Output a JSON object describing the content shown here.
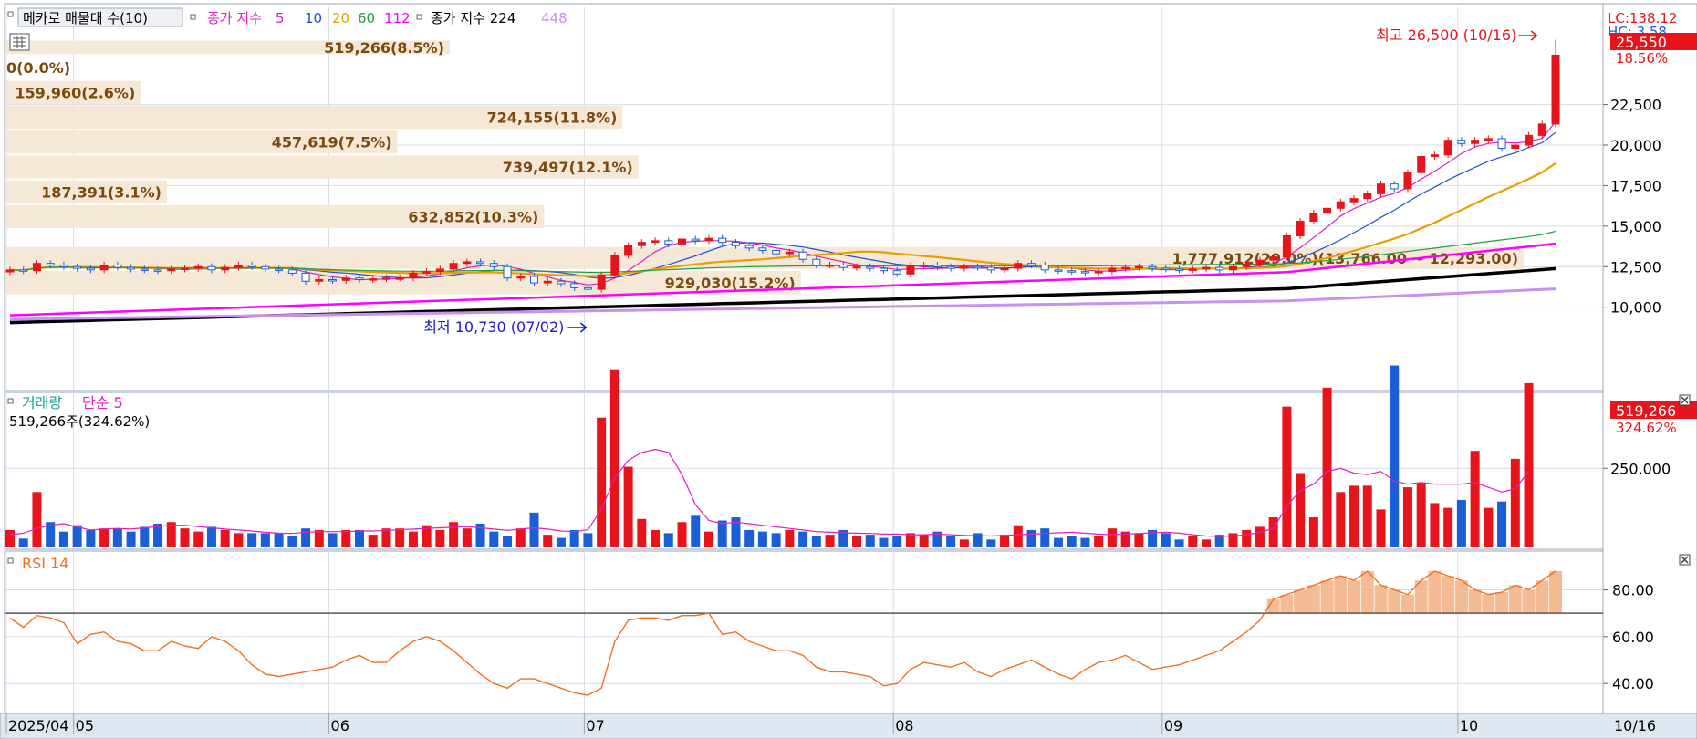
{
  "chart_data": [
    {
      "type": "candlestick",
      "legend": {
        "toggle_label": "메카로 매물대 수(10)",
        "ma_label": "종가 지수",
        "ma_periods": [
          {
            "label": "5",
            "color": "#e020c0"
          },
          {
            "label": "10",
            "color": "#2050d0"
          },
          {
            "label": "20",
            "color": "#e8a000"
          },
          {
            "label": "60",
            "color": "#20a040"
          },
          {
            "label": "112",
            "color": "#ff00ff"
          }
        ],
        "ma2_label": "종가 지수 224",
        "ma2_color": "#000000",
        "ma3_label": "448",
        "ma3_color": "#c890f0"
      },
      "ylim": [
        8800,
        28500
      ],
      "y_ticks": [
        "22,500",
        "20,000",
        "17,500",
        "15,000",
        "12,500",
        "10,000"
      ],
      "y_tick_values": [
        22500,
        20000,
        17500,
        15000,
        12500,
        10000
      ],
      "lc_label": "LC:138.12",
      "hc_label": "HC: 3.58",
      "price_box": "25,550",
      "change_pct": "18.56%",
      "high_annotation": "최고 26,500 (10/16)",
      "low_annotation": "최저 10,730 (07/02)",
      "colors": {
        "up": "#e8141c",
        "down": "#1a5fd6",
        "profile": "#f5e6d3",
        "profile_text": "#7a4a10",
        "rsi": "#f07020",
        "rsi_fill": "#f4b48a"
      },
      "volume_profile": [
        {
          "label": "519,266(8.5%)",
          "pct": 8.5,
          "low": 25550,
          "high": 26500
        },
        {
          "label": "0(0.0%)",
          "pct": 0.0,
          "low": 24010,
          "high": 25550
        },
        {
          "label": "159,960(2.6%)",
          "pct": 2.6,
          "low": 22480,
          "high": 24010
        },
        {
          "label": "724,155(11.8%)",
          "pct": 11.8,
          "low": 20950,
          "high": 22480
        },
        {
          "label": "457,619(7.5%)",
          "pct": 7.5,
          "low": 19420,
          "high": 20950
        },
        {
          "label": "739,497(12.1%)",
          "pct": 12.1,
          "low": 17880,
          "high": 19420
        },
        {
          "label": "187,391(3.1%)",
          "pct": 3.1,
          "low": 16350,
          "high": 17880
        },
        {
          "label": "632,852(10.3%)",
          "pct": 10.3,
          "low": 14820,
          "high": 16350
        },
        {
          "label": "1,777,912(29.0%)(13,766.00 ~ 12,293.00)",
          "pct": 29.0,
          "low": 12293,
          "high": 13766
        },
        {
          "label": "929,030(15.2%)",
          "pct": 15.2,
          "low": 10730,
          "high": 12293
        }
      ],
      "x_labels": [
        {
          "label": "2025/04",
          "index": 0
        },
        {
          "label": "05",
          "index": 5
        },
        {
          "label": "06",
          "index": 24
        },
        {
          "label": "07",
          "index": 43
        },
        {
          "label": "08",
          "index": 66
        },
        {
          "label": "09",
          "index": 86
        },
        {
          "label": "10",
          "index": 108
        }
      ],
      "date_box": "10/16",
      "highlight": {
        "high_index": 114,
        "low_index": 43
      },
      "close": [
        12300,
        12250,
        12700,
        12600,
        12500,
        12400,
        12300,
        12600,
        12450,
        12350,
        12300,
        12250,
        12350,
        12400,
        12500,
        12300,
        12450,
        12600,
        12500,
        12350,
        12300,
        12100,
        11600,
        11700,
        11650,
        11800,
        11700,
        11750,
        11800,
        11800,
        12100,
        12200,
        12350,
        12700,
        12800,
        12700,
        12500,
        11800,
        11900,
        11500,
        11600,
        11450,
        11200,
        11100,
        12000,
        13200,
        13800,
        14000,
        14100,
        13900,
        14200,
        14100,
        14250,
        14000,
        13800,
        13650,
        13500,
        13300,
        13400,
        12950,
        12600,
        12600,
        12450,
        12500,
        12400,
        12250,
        12050,
        12550,
        12600,
        12500,
        12400,
        12500,
        12450,
        12300,
        12400,
        12700,
        12600,
        12300,
        12250,
        12200,
        12150,
        12200,
        12400,
        12450,
        12500,
        12400,
        12350,
        12300,
        12350,
        12450,
        12300,
        12500,
        12650,
        12900,
        13100,
        14400,
        15300,
        15800,
        16100,
        16500,
        16700,
        17000,
        17600,
        17300,
        18300,
        19300,
        19400,
        20300,
        20100,
        20300,
        20400,
        19800,
        20000,
        20600,
        21300,
        25550
      ],
      "volume": [
        55000,
        28000,
        175000,
        80000,
        50000,
        70000,
        55000,
        60000,
        60000,
        50000,
        65000,
        75000,
        80000,
        60000,
        50000,
        65000,
        55000,
        45000,
        45000,
        45000,
        45000,
        35000,
        60000,
        55000,
        45000,
        55000,
        55000,
        40000,
        60000,
        60000,
        50000,
        70000,
        55000,
        80000,
        60000,
        75000,
        50000,
        35000,
        60000,
        110000,
        40000,
        30000,
        55000,
        45000,
        410000,
        560000,
        255000,
        90000,
        55000,
        45000,
        80000,
        100000,
        50000,
        85000,
        95000,
        55000,
        50000,
        45000,
        55000,
        50000,
        35000,
        40000,
        55000,
        35000,
        40000,
        30000,
        35000,
        45000,
        40000,
        50000,
        35000,
        25000,
        45000,
        25000,
        40000,
        70000,
        55000,
        60000,
        30000,
        35000,
        30000,
        35000,
        60000,
        50000,
        45000,
        55000,
        45000,
        25000,
        35000,
        25000,
        40000,
        45000,
        55000,
        65000,
        95000,
        445000,
        235000,
        95000,
        505000,
        175000,
        195000,
        195000,
        120000,
        575000,
        190000,
        205000,
        140000,
        125000,
        150000,
        305000,
        125000,
        145000,
        280000,
        519266
      ]
    },
    {
      "type": "bar",
      "legend": {
        "title": "거래량",
        "ma_label": "단순 5",
        "title_color": "#20a090",
        "ma_color": "#e020c0"
      },
      "volume_label": "519,266주(324.62%)",
      "value_box": "519,266",
      "pct_box": "324.62%",
      "y_ticks": [
        "250,000"
      ],
      "ylim": [
        0,
        640000
      ],
      "ma5": [
        40000,
        45000,
        60000,
        70000,
        75000,
        65000,
        55000,
        58000,
        60000,
        58000,
        62000,
        66000,
        70000,
        70000,
        66000,
        62000,
        58000,
        55000,
        52000,
        48000,
        45000,
        44000,
        48000,
        50000,
        50000,
        50000,
        52000,
        52000,
        54000,
        56000,
        58000,
        60000,
        62000,
        64000,
        66000,
        62000,
        58000,
        54000,
        58000,
        62000,
        58000,
        52000,
        50000,
        56000,
        120000,
        220000,
        275000,
        300000,
        310000,
        300000,
        230000,
        135000,
        85000,
        75000,
        80000,
        75000,
        70000,
        65000,
        60000,
        55000,
        50000,
        48000,
        46000,
        45000,
        44000,
        42000,
        42000,
        40000,
        40000,
        42000,
        40000,
        38000,
        37000,
        36000,
        38000,
        40000,
        42000,
        44000,
        46000,
        48000,
        45000,
        42000,
        40000,
        42000,
        44000,
        46000,
        48000,
        45000,
        40000,
        36000,
        35000,
        36000,
        40000,
        48000,
        60000,
        130000,
        180000,
        200000,
        240000,
        250000,
        235000,
        230000,
        240000,
        210000,
        200000,
        205000,
        200000,
        200000,
        200000,
        205000,
        190000,
        175000,
        185000,
        240000
      ]
    },
    {
      "type": "line",
      "legend": {
        "title": "RSI 14"
      },
      "y_ticks": [
        "80.00",
        "60.00",
        "40.00"
      ],
      "y_tick_values": [
        80,
        60,
        40
      ],
      "ylim": [
        28,
        95
      ],
      "threshold": 70,
      "values": [
        68,
        64,
        69,
        68,
        66,
        57,
        61,
        62,
        58,
        57,
        54,
        54,
        58,
        56,
        55,
        60,
        58,
        54,
        48,
        44,
        43,
        44,
        45,
        46,
        47,
        50,
        52,
        49,
        49,
        54,
        58,
        60,
        58,
        54,
        49,
        44,
        40,
        38,
        42,
        42,
        40,
        38,
        36,
        35,
        38,
        58,
        67,
        68,
        68,
        67,
        69,
        69,
        70,
        61,
        62,
        58,
        56,
        54,
        54,
        52,
        47,
        45,
        45,
        44,
        43,
        39,
        40,
        46,
        49,
        48,
        47,
        49,
        45,
        43,
        46,
        48,
        50,
        47,
        44,
        42,
        46,
        49,
        50,
        52,
        49,
        46,
        47,
        48,
        50,
        52,
        54,
        58,
        62,
        67,
        76,
        78,
        80,
        82,
        84,
        86,
        84,
        88,
        82,
        80,
        78,
        84,
        88,
        86,
        84,
        80,
        78,
        79,
        82,
        80,
        84,
        88
      ]
    },
    {
      "type": "axis",
      "note": "shared date axis",
      "x_labels_ref": "chart_data.0.x_labels"
    }
  ]
}
